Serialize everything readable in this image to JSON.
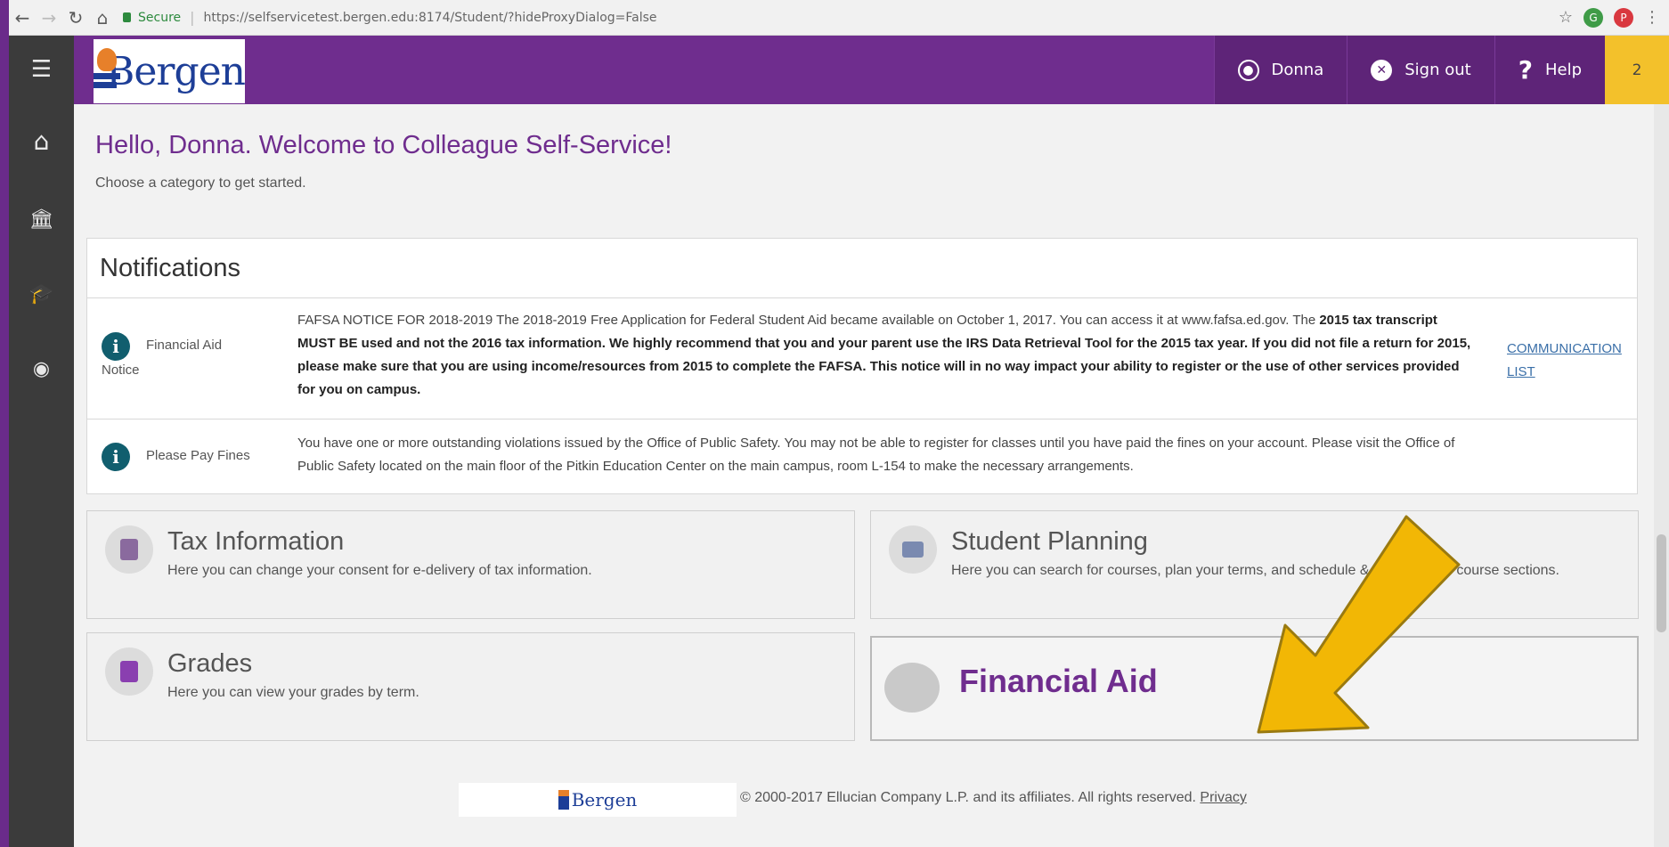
{
  "browser": {
    "secure_label": "Secure",
    "url": "https://selfservicetest.bergen.edu:8174/Student/?hideProxyDialog=False"
  },
  "header": {
    "logo_text": "Bergen",
    "user_label": "Donna",
    "signout_label": "Sign out",
    "help_label": "Help",
    "notification_count": "2",
    "brand_color": "#6f2d8e",
    "accent_color": "#f3c12b"
  },
  "nav_icons": [
    "menu-icon",
    "home-icon",
    "institution-icon",
    "graduation-cap-icon",
    "user-circle-icon"
  ],
  "welcome": {
    "title": "Hello, Donna. Welcome to Colleague Self-Service!",
    "subtitle": "Choose a category to get started."
  },
  "notifications": {
    "heading": "Notifications",
    "items": [
      {
        "category": "Financial Aid",
        "category_sub": "Notice",
        "message_plain": "FAFSA NOTICE FOR 2018-2019 The 2018-2019 Free Application for Federal Student Aid became available on October 1, 2017. You can access it at www.fafsa.ed.gov. The ",
        "message_bold": "2015 tax transcript MUST BE used and not the 2016 tax information. We highly recommend that you and your parent use the IRS Data Retrieval Tool for the 2015 tax year. If you did not file a return for 2015, please make sure that you are using income/resources from 2015 to complete the FAFSA. This notice will in no way impact your ability to register or the use of other services provided for you on campus.",
        "link": "COMMUNICATION LIST"
      },
      {
        "category": "Please Pay Fines",
        "message_plain": "You have one or more outstanding violations issued by the Office of Public Safety. You may not be able to register for classes until you have paid the fines on your account. Please visit the Office of Public Safety located on the main floor of the Pitkin Education Center on the main campus, room L-154 to make the necessary arrangements."
      }
    ]
  },
  "tiles": {
    "tax": {
      "title": "Tax Information",
      "desc": "Here you can change your consent for e-delivery of tax information."
    },
    "planning": {
      "title": "Student Planning",
      "desc": "Here you can search for courses, plan your terms, and schedule & register your course sections."
    },
    "grades": {
      "title": "Grades",
      "desc": "Here you can view your grades by term."
    },
    "finaid": {
      "title": "Financial Aid"
    }
  },
  "annotation": {
    "arrow_color": "#f2b705",
    "arrow_meaning": "pointer to Financial Aid tile"
  },
  "footer": {
    "logo_text": "Bergen",
    "copyright": "© 2000-2017 Ellucian Company L.P. and its affiliates. All rights reserved.",
    "privacy_label": "Privacy"
  }
}
